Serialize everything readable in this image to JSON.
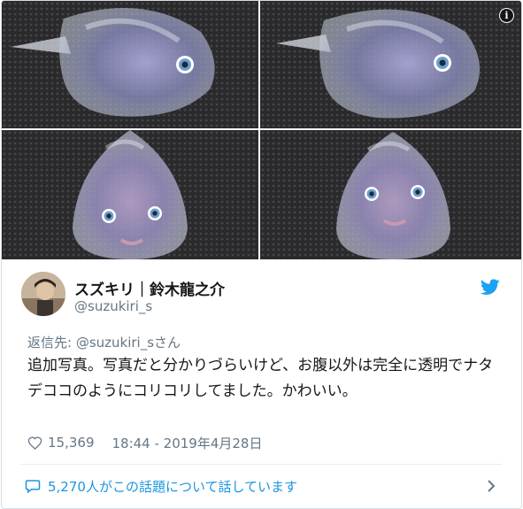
{
  "tweet": {
    "display_name": "スズキリ｜鈴木龍之介",
    "handle": "@suzukiri_s",
    "reply_to": "返信先: @suzukiri_sさん",
    "text": "追加写真。写真だと分かりづらいけど、お腹以外は完全に透明でナタデココのようにコリコリしてました。かわいい。",
    "likes": "15,369",
    "timestamp": "18:44 - 2019年4月28日",
    "conversation_label": "5,270人がこの話題について話しています"
  },
  "media": {
    "info_glyph": "i",
    "photos": [
      "fish-profile-left",
      "fish-profile-right",
      "fish-front-left",
      "fish-front-right"
    ]
  },
  "colors": {
    "accent": "#1b95e0",
    "twitter_blue": "#1da1f2",
    "secondary_text": "#657786",
    "primary_text": "#14171a"
  },
  "icons": {
    "info": "info-icon",
    "brand": "twitter-bird-icon",
    "like": "heart-icon",
    "conversation": "speech-bubble-icon",
    "more": "chevron-right-icon"
  }
}
